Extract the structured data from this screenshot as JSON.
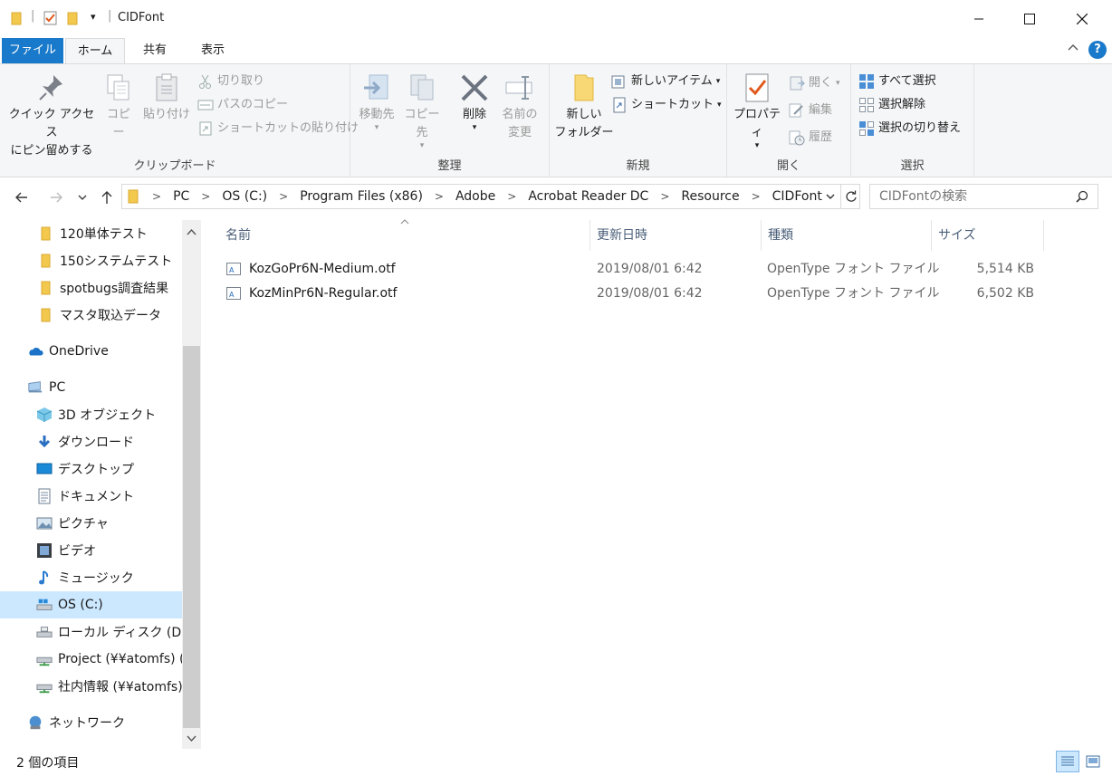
{
  "window": {
    "title": "CIDFont",
    "qat_dropdown": "▾"
  },
  "ribbon_tabs": {
    "file": "ファイル",
    "home": "ホーム",
    "share": "共有",
    "view": "表示"
  },
  "ribbon": {
    "clipboard": {
      "label": "クリップボード",
      "pin_line1": "クイック アクセス",
      "pin_line2": "にピン留めする",
      "copy": "コピー",
      "paste": "貼り付け",
      "cut": "切り取り",
      "copy_path": "パスのコピー",
      "paste_shortcut": "ショートカットの貼り付け"
    },
    "organize": {
      "label": "整理",
      "move_to": "移動先",
      "copy_to": "コピー先",
      "delete": "削除",
      "rename_line1": "名前の",
      "rename_line2": "変更"
    },
    "new": {
      "label": "新規",
      "new_folder_line1": "新しい",
      "new_folder_line2": "フォルダー",
      "new_item": "新しいアイテム",
      "easy_access": "ショートカット"
    },
    "open": {
      "label": "開く",
      "properties": "プロパティ",
      "open": "開く",
      "edit": "編集",
      "history": "履歴"
    },
    "select": {
      "label": "選択",
      "select_all": "すべて選択",
      "select_none": "選択解除",
      "invert": "選択の切り替え"
    }
  },
  "address": {
    "crumbs": [
      "PC",
      "OS (C:)",
      "Program Files (x86)",
      "Adobe",
      "Acrobat Reader DC",
      "Resource",
      "CIDFont"
    ],
    "search_placeholder": "CIDFontの検索"
  },
  "nav": {
    "items": [
      {
        "label": "120単体テスト",
        "icon": "folder-icon"
      },
      {
        "label": "150システムテスト",
        "icon": "folder-icon"
      },
      {
        "label": "spotbugs調査結果",
        "icon": "folder-icon"
      },
      {
        "label": "マスタ取込データ",
        "icon": "folder-icon"
      },
      {
        "label": "OneDrive",
        "icon": "onedrive-icon"
      },
      {
        "label": "PC",
        "icon": "pc-icon"
      },
      {
        "label": "3D オブジェクト",
        "icon": "3d-objects-icon"
      },
      {
        "label": "ダウンロード",
        "icon": "download-icon"
      },
      {
        "label": "デスクトップ",
        "icon": "desktop-icon"
      },
      {
        "label": "ドキュメント",
        "icon": "documents-icon"
      },
      {
        "label": "ピクチャ",
        "icon": "pictures-icon"
      },
      {
        "label": "ビデオ",
        "icon": "videos-icon"
      },
      {
        "label": "ミュージック",
        "icon": "music-icon"
      },
      {
        "label": "OS (C:)",
        "icon": "os-drive-icon"
      },
      {
        "label": "ローカル ディスク (D:)",
        "icon": "disk-icon"
      },
      {
        "label": "Project (¥¥atomfs) (G:)",
        "icon": "network-drive-icon"
      },
      {
        "label": "社内情報 (¥¥atomfs) (",
        "icon": "network-drive-icon"
      },
      {
        "label": "ネットワーク",
        "icon": "network-icon"
      }
    ]
  },
  "columns": {
    "name": "名前",
    "date": "更新日時",
    "type": "種類",
    "size": "サイズ"
  },
  "files": [
    {
      "name": "KozGoPr6N-Medium.otf",
      "date": "2019/08/01 6:42",
      "type": "OpenType フォント ファイル",
      "size": "5,514 KB"
    },
    {
      "name": "KozMinPr6N-Regular.otf",
      "date": "2019/08/01 6:42",
      "type": "OpenType フォント ファイル",
      "size": "6,502 KB"
    }
  ],
  "status": {
    "item_count": "2 個の項目"
  },
  "colors": {
    "accent": "#1979ca",
    "selection": "#cce8ff",
    "folder": "#f8d775"
  }
}
